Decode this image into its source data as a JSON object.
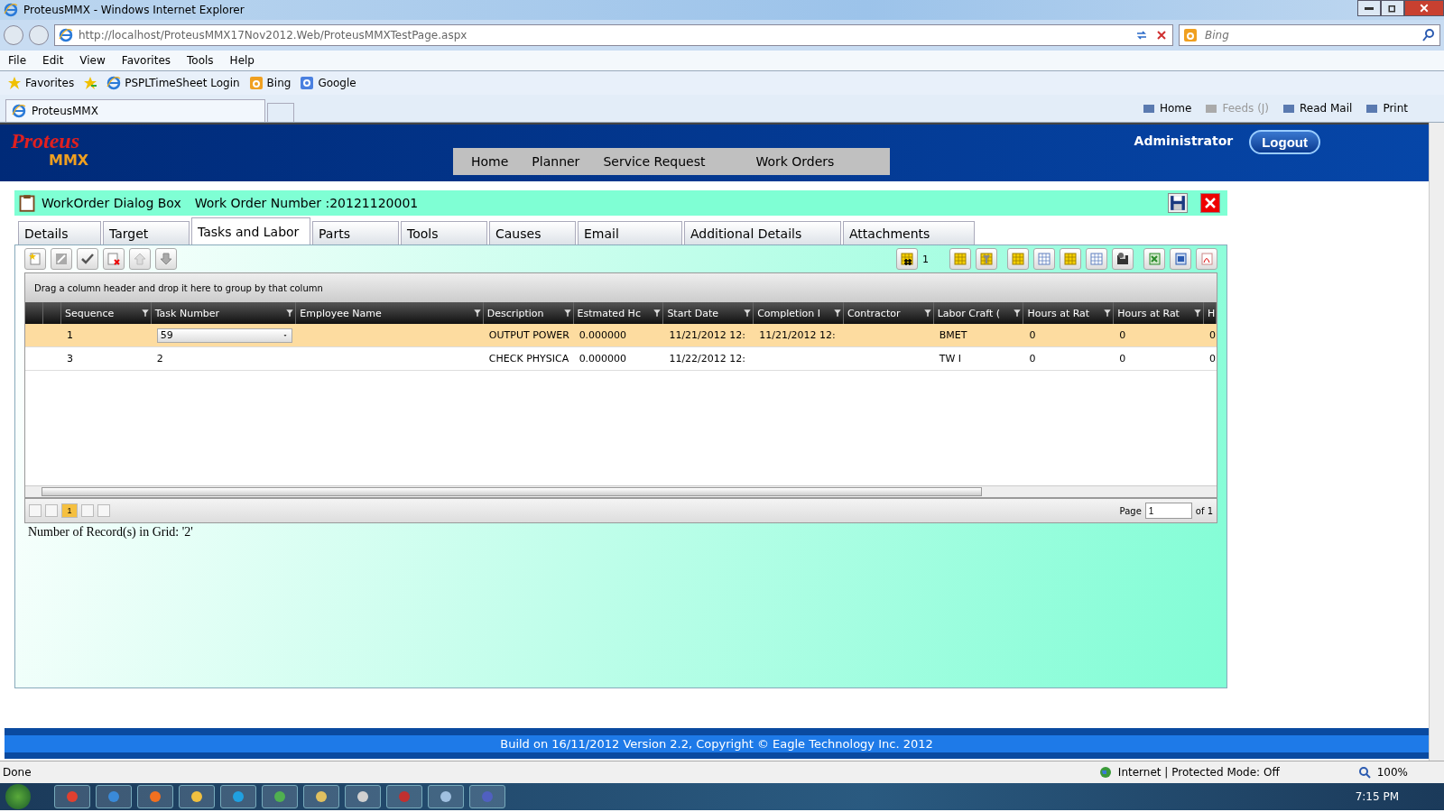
{
  "browser": {
    "title": "ProteusMMX - Windows Internet Explorer",
    "address": "http://localhost/ProteusMMX17Nov2012.Web/ProteusMMXTestPage.aspx",
    "search_placeholder": "Bing",
    "menu": [
      "File",
      "Edit",
      "View",
      "Favorites",
      "Tools",
      "Help"
    ],
    "favorites_label": "Favorites",
    "favorites": [
      "PSPLTimeSheet Login",
      "Bing",
      "Google"
    ],
    "tab": "ProteusMMX",
    "command_bar": [
      {
        "label": "Home",
        "disabled": false
      },
      {
        "label": "Feeds (J)",
        "disabled": true
      },
      {
        "label": "Read Mail",
        "disabled": false
      },
      {
        "label": "Print",
        "disabled": false
      }
    ]
  },
  "header": {
    "logo": [
      "Proteus",
      "MMX"
    ],
    "user": "Administrator",
    "logout": "Logout",
    "nav": [
      "Home",
      "Planner",
      "Service Request",
      "Work Orders"
    ]
  },
  "dialog": {
    "title": "WorkOrder Dialog Box",
    "work_order": "Work Order Number :20121120001",
    "tabs": [
      {
        "label": "Details",
        "selected": false
      },
      {
        "label": "Target",
        "selected": false
      },
      {
        "label": "Tasks and Labor",
        "selected": true
      },
      {
        "label": "Parts",
        "selected": false
      },
      {
        "label": "Tools",
        "selected": false
      },
      {
        "label": "Causes",
        "selected": false
      },
      {
        "label": "Email",
        "selected": false
      },
      {
        "label": "Additional Details",
        "selected": false
      },
      {
        "label": "Attachments",
        "selected": false
      }
    ],
    "toolbar_count": "1",
    "group_hint": "Drag a column header and drop it here to group by that column",
    "columns": [
      "Sequence",
      "Task Number",
      "Employee Name",
      "Description",
      "Estmated Hc",
      "Start Date",
      "Completion I",
      "Contractor",
      "Labor Craft (",
      "Hours at Rat",
      "Hours at Rat",
      "H"
    ],
    "rows": [
      {
        "selected": true,
        "editing": true,
        "cells": [
          "1",
          "59",
          null,
          "OUTPUT POWER",
          "0.000000",
          "11/21/2012 12:",
          "11/21/2012 12:",
          null,
          "BMET",
          "0",
          "0",
          "0"
        ]
      },
      {
        "selected": false,
        "editing": false,
        "cells": [
          "3",
          "2",
          null,
          "CHECK PHYSICA",
          "0.000000",
          "11/22/2012 12:",
          null,
          null,
          "TW I",
          "0",
          "0",
          "0"
        ]
      }
    ],
    "pager": {
      "pages": [
        {
          "label": "1",
          "selected": true
        }
      ],
      "page_label": "Page",
      "page_value": "1",
      "of_label": "of 1"
    },
    "record_count": "Number of Record(s) in Grid: '2'"
  },
  "footer": "Build on 16/11/2012 Version 2.2, Copyright © Eagle Technology Inc. 2012",
  "status_bar": {
    "left": "Done",
    "zone": "Internet | Protected Mode: Off",
    "zoom": "100%"
  },
  "taskbar": {
    "clock": "7:15 PM"
  }
}
